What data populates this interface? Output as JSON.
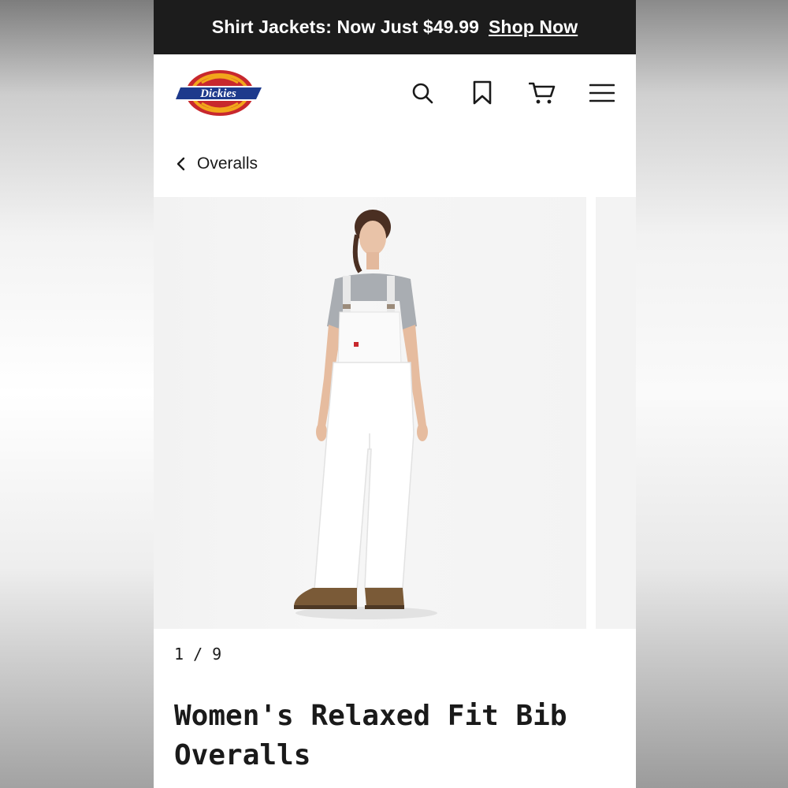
{
  "promo": {
    "text": "Shirt Jackets: Now Just $49.99",
    "link": "Shop Now"
  },
  "brand": {
    "logo_text": "Dickies",
    "colors": {
      "navy": "#1e3a8c",
      "red": "#c8282d",
      "gold": "#f2a71b"
    }
  },
  "header": {
    "icons": [
      "search-icon",
      "bookmark-icon",
      "cart-icon",
      "menu-icon"
    ]
  },
  "breadcrumb": {
    "label": "Overalls"
  },
  "gallery": {
    "counter": "1 / 9"
  },
  "product": {
    "title": "Women's Relaxed Fit Bib Overalls"
  },
  "colors": {
    "promo_bg": "#1c1c1c",
    "text": "#1a1a1a",
    "overall_white": "#ffffff",
    "shirt_grey": "#a9adb2",
    "boot_brown": "#7a5a37"
  }
}
